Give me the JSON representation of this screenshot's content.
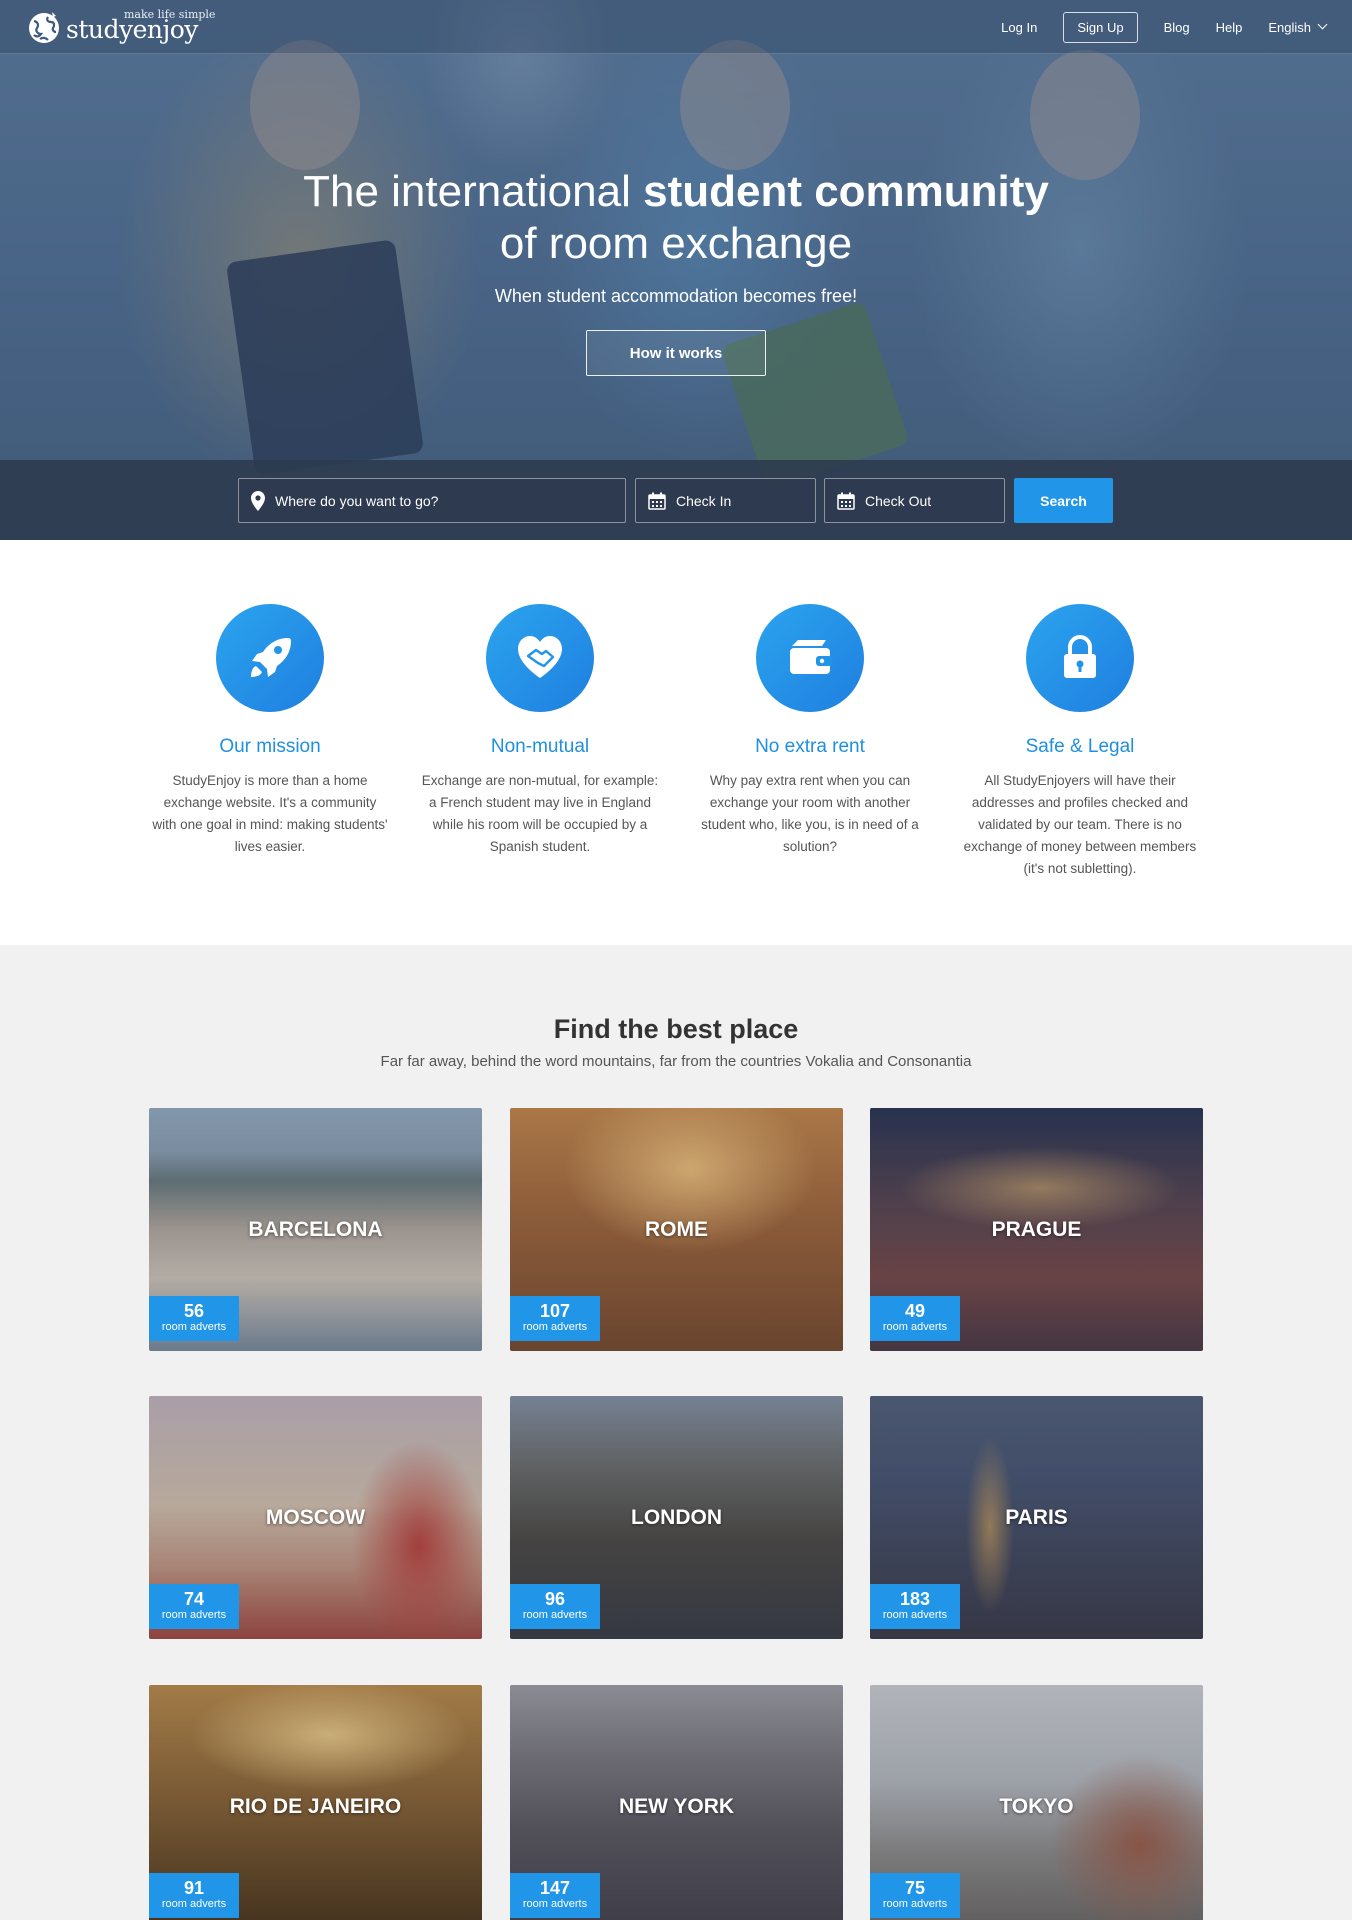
{
  "brand": {
    "name": "studyenjoy",
    "tagline": "make life simple"
  },
  "nav": {
    "login": "Log In",
    "signup": "Sign Up",
    "blog": "Blog",
    "help": "Help",
    "language": "English"
  },
  "hero": {
    "title_light": "The international ",
    "title_bold": "student community",
    "title_line2": "of room exchange",
    "subtitle": "When student accommodation becomes free!",
    "cta": "How it works"
  },
  "search": {
    "where_placeholder": "Where do you want to go?",
    "checkin_placeholder": "Check In",
    "checkout_placeholder": "Check Out",
    "button": "Search"
  },
  "features": [
    {
      "icon": "rocket-icon",
      "title": "Our mission",
      "text": "StudyEnjoy is more than a home exchange website. It's a community with one goal in mind: making students' lives easier."
    },
    {
      "icon": "heart-handshake-icon",
      "title": "Non-mutual",
      "text": "Exchange are non-mutual, for example: a French student may live in England while his room will be occupied by a Spanish student."
    },
    {
      "icon": "wallet-icon",
      "title": "No extra rent",
      "text": "Why pay extra rent when you can exchange your room with another student who, like you, is in need of a solution?"
    },
    {
      "icon": "lock-icon",
      "title": "Safe & Legal",
      "text": "All StudyEnjoyers will have their addresses and profiles checked and validated by our team. There is no exchange of money between members (it's not subletting)."
    }
  ],
  "places": {
    "title": "Find the best place",
    "subtitle": "Far far away, behind the word mountains, far from the countries Vokalia and Consonantia",
    "cities": [
      {
        "name": "BARCELONA",
        "count": "56",
        "label": "room adverts"
      },
      {
        "name": "ROME",
        "count": "107",
        "label": "room adverts"
      },
      {
        "name": "PRAGUE",
        "count": "49",
        "label": "room adverts"
      },
      {
        "name": "MOSCOW",
        "count": "74",
        "label": "room adverts"
      },
      {
        "name": "LONDON",
        "count": "96",
        "label": "room adverts"
      },
      {
        "name": "PARIS",
        "count": "183",
        "label": "room adverts"
      },
      {
        "name": "RIO DE JANEIRO",
        "count": "91",
        "label": "room adverts"
      },
      {
        "name": "NEW YORK",
        "count": "147",
        "label": "room adverts"
      },
      {
        "name": "TOKYO",
        "count": "75",
        "label": "room adverts"
      }
    ]
  },
  "colors": {
    "accent": "#2196e8",
    "feature_title": "#1f8fe0",
    "search_bar": "#2d3a4e"
  }
}
